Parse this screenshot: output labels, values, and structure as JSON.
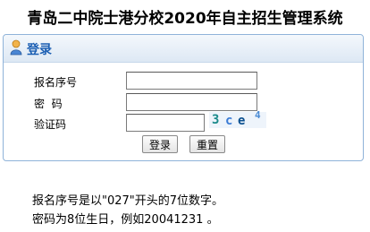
{
  "page": {
    "title": "青岛二中院士港分校2020年自主招生管理系统"
  },
  "login_panel": {
    "title": "登录",
    "fields": {
      "registration_label": "报名序号",
      "registration_value": "",
      "password_label": "密  码",
      "password_value": "",
      "captcha_label": "验证码",
      "captcha_value": ""
    },
    "captcha_image_text": [
      "3",
      "c",
      "e",
      "4"
    ],
    "buttons": {
      "login": "登录",
      "reset": "重置"
    }
  },
  "notes": {
    "line1": "报名序号是以\"027\"开头的7位数字。",
    "line2": "密码为8位生日，例如20041231 。"
  },
  "colors": {
    "panel_border": "#8fb3d9",
    "title_blue": "#1c5fb3",
    "captcha_chars": [
      "#1a8a8a",
      "#3a7bd5",
      "#0a4f8f",
      "#4b8bd4"
    ]
  },
  "icons": {
    "user": "user-icon"
  }
}
